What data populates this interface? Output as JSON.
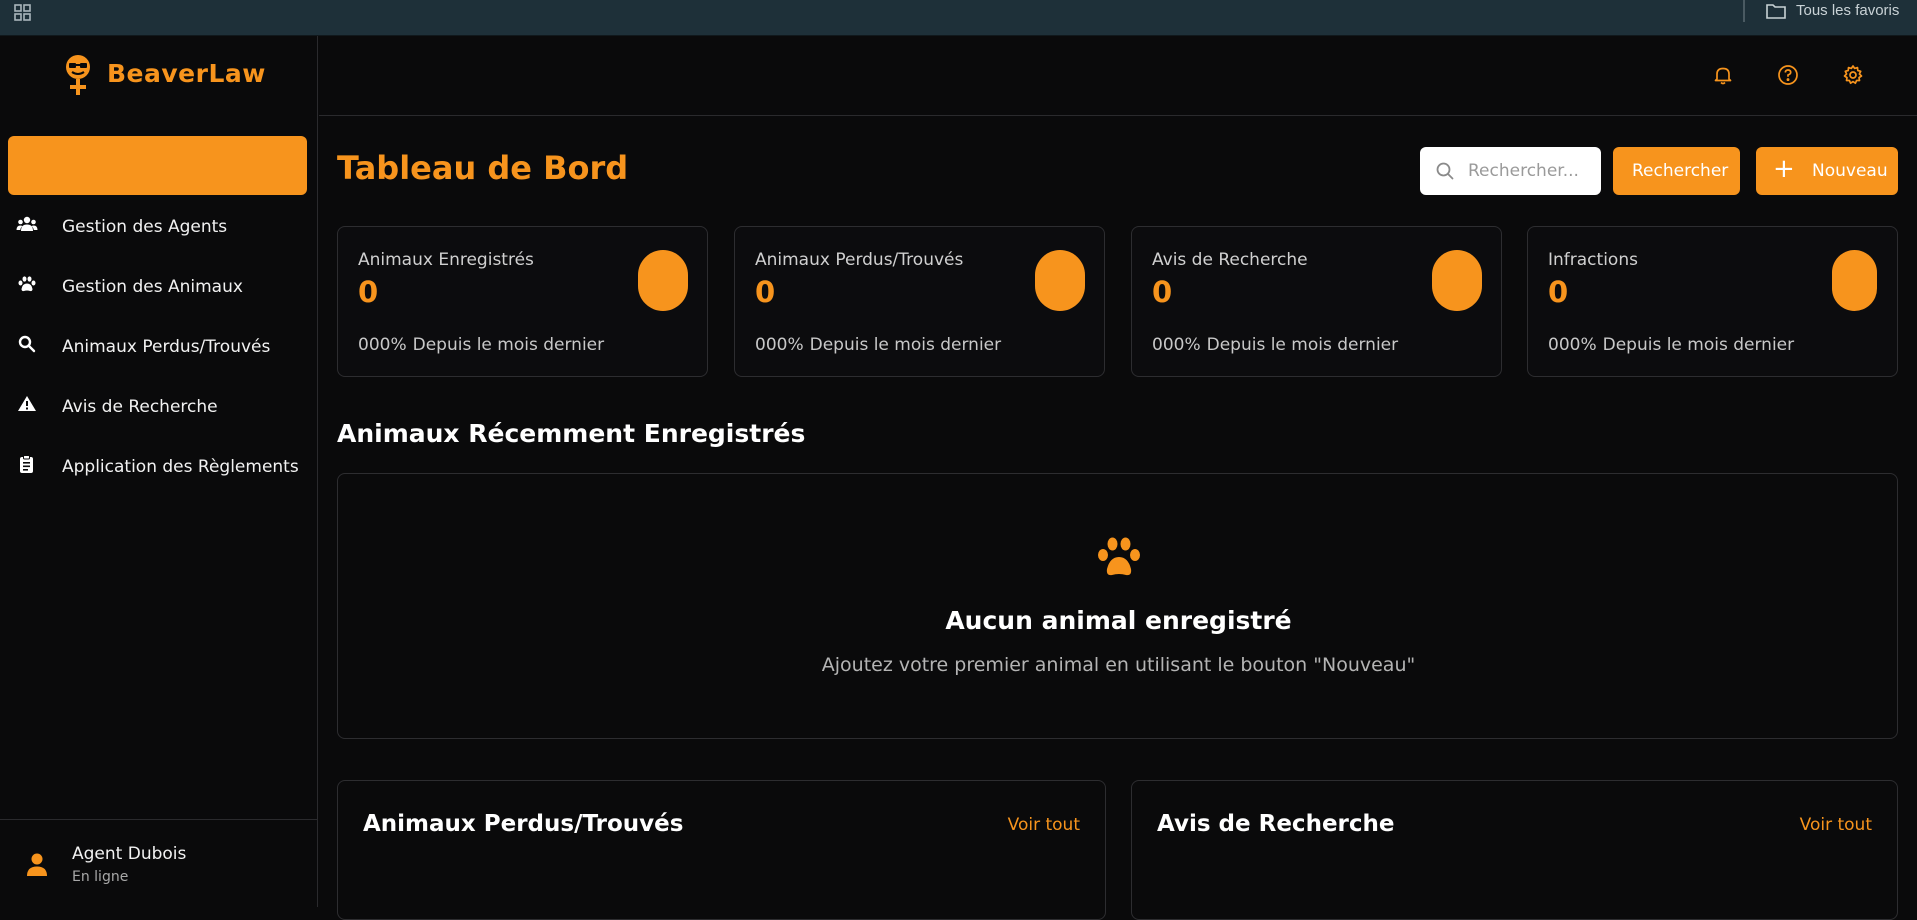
{
  "bookmarks": {
    "folder_label": "Tous les favoris"
  },
  "sidebar": {
    "brand": "BeaverLaw",
    "items": [
      {
        "label": "Gestion des Agents",
        "icon": "users-icon"
      },
      {
        "label": "Gestion des Animaux",
        "icon": "paw-icon"
      },
      {
        "label": "Animaux Perdus/Trouvés",
        "icon": "search-icon"
      },
      {
        "label": "Avis de Recherche",
        "icon": "warning-icon"
      },
      {
        "label": "Application des Règlements",
        "icon": "clipboard-icon"
      }
    ],
    "user": {
      "name": "Agent Dubois",
      "status": "En ligne"
    }
  },
  "header": {
    "icons": [
      "bell-icon",
      "help-icon",
      "gear-icon"
    ]
  },
  "main": {
    "title": "Tableau de Bord",
    "search": {
      "placeholder": "Rechercher...",
      "value": ""
    },
    "search_button": "Rechercher",
    "new_button": "Nouveau",
    "stats": [
      {
        "title": "Animaux Enregistrés",
        "value": "0",
        "change": "000%",
        "period": "Depuis le mois dernier"
      },
      {
        "title": "Animaux Perdus/Trouvés",
        "value": "0",
        "change": "000%",
        "period": "Depuis le mois dernier"
      },
      {
        "title": "Avis de Recherche",
        "value": "0",
        "change": "000%",
        "period": "Depuis le mois dernier"
      },
      {
        "title": "Infractions",
        "value": "0",
        "change": "000%",
        "period": "Depuis le mois dernier"
      }
    ],
    "recent_title": "Animaux Récemment Enregistrés",
    "empty": {
      "title": "Aucun animal enregistré",
      "subtitle": "Ajoutez votre premier animal en utilisant le bouton \"Nouveau\""
    },
    "panels": [
      {
        "title": "Animaux Perdus/Trouvés",
        "link": "Voir tout"
      },
      {
        "title": "Avis de Recherche",
        "link": "Voir tout"
      }
    ]
  },
  "colors": {
    "accent": "#f7941d",
    "background": "#0a0a0b",
    "bookmarks_bar": "#1e3039"
  }
}
